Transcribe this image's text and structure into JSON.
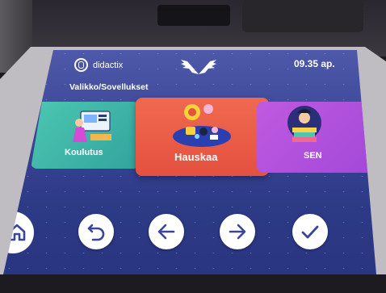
{
  "header": {
    "brand_name": "didactix",
    "time": "09.35 ap."
  },
  "breadcrumb": "Valikko/Sovellukset",
  "tiles": [
    {
      "label": "Koulutus",
      "color": "#3fb7a8"
    },
    {
      "label": "Hauskaa",
      "color": "#ea5c46"
    },
    {
      "label": "SEN",
      "color": "#b050dc"
    }
  ],
  "nav": {
    "home_icon": "home-icon",
    "back_icon": "undo-icon",
    "prev_icon": "arrow-left-icon",
    "next_icon": "arrow-right-icon",
    "ok_icon": "check-icon"
  },
  "colors": {
    "screen_top": "#5a64b4",
    "screen_bottom": "#2a3480",
    "icon_stroke": "#3b4698"
  }
}
